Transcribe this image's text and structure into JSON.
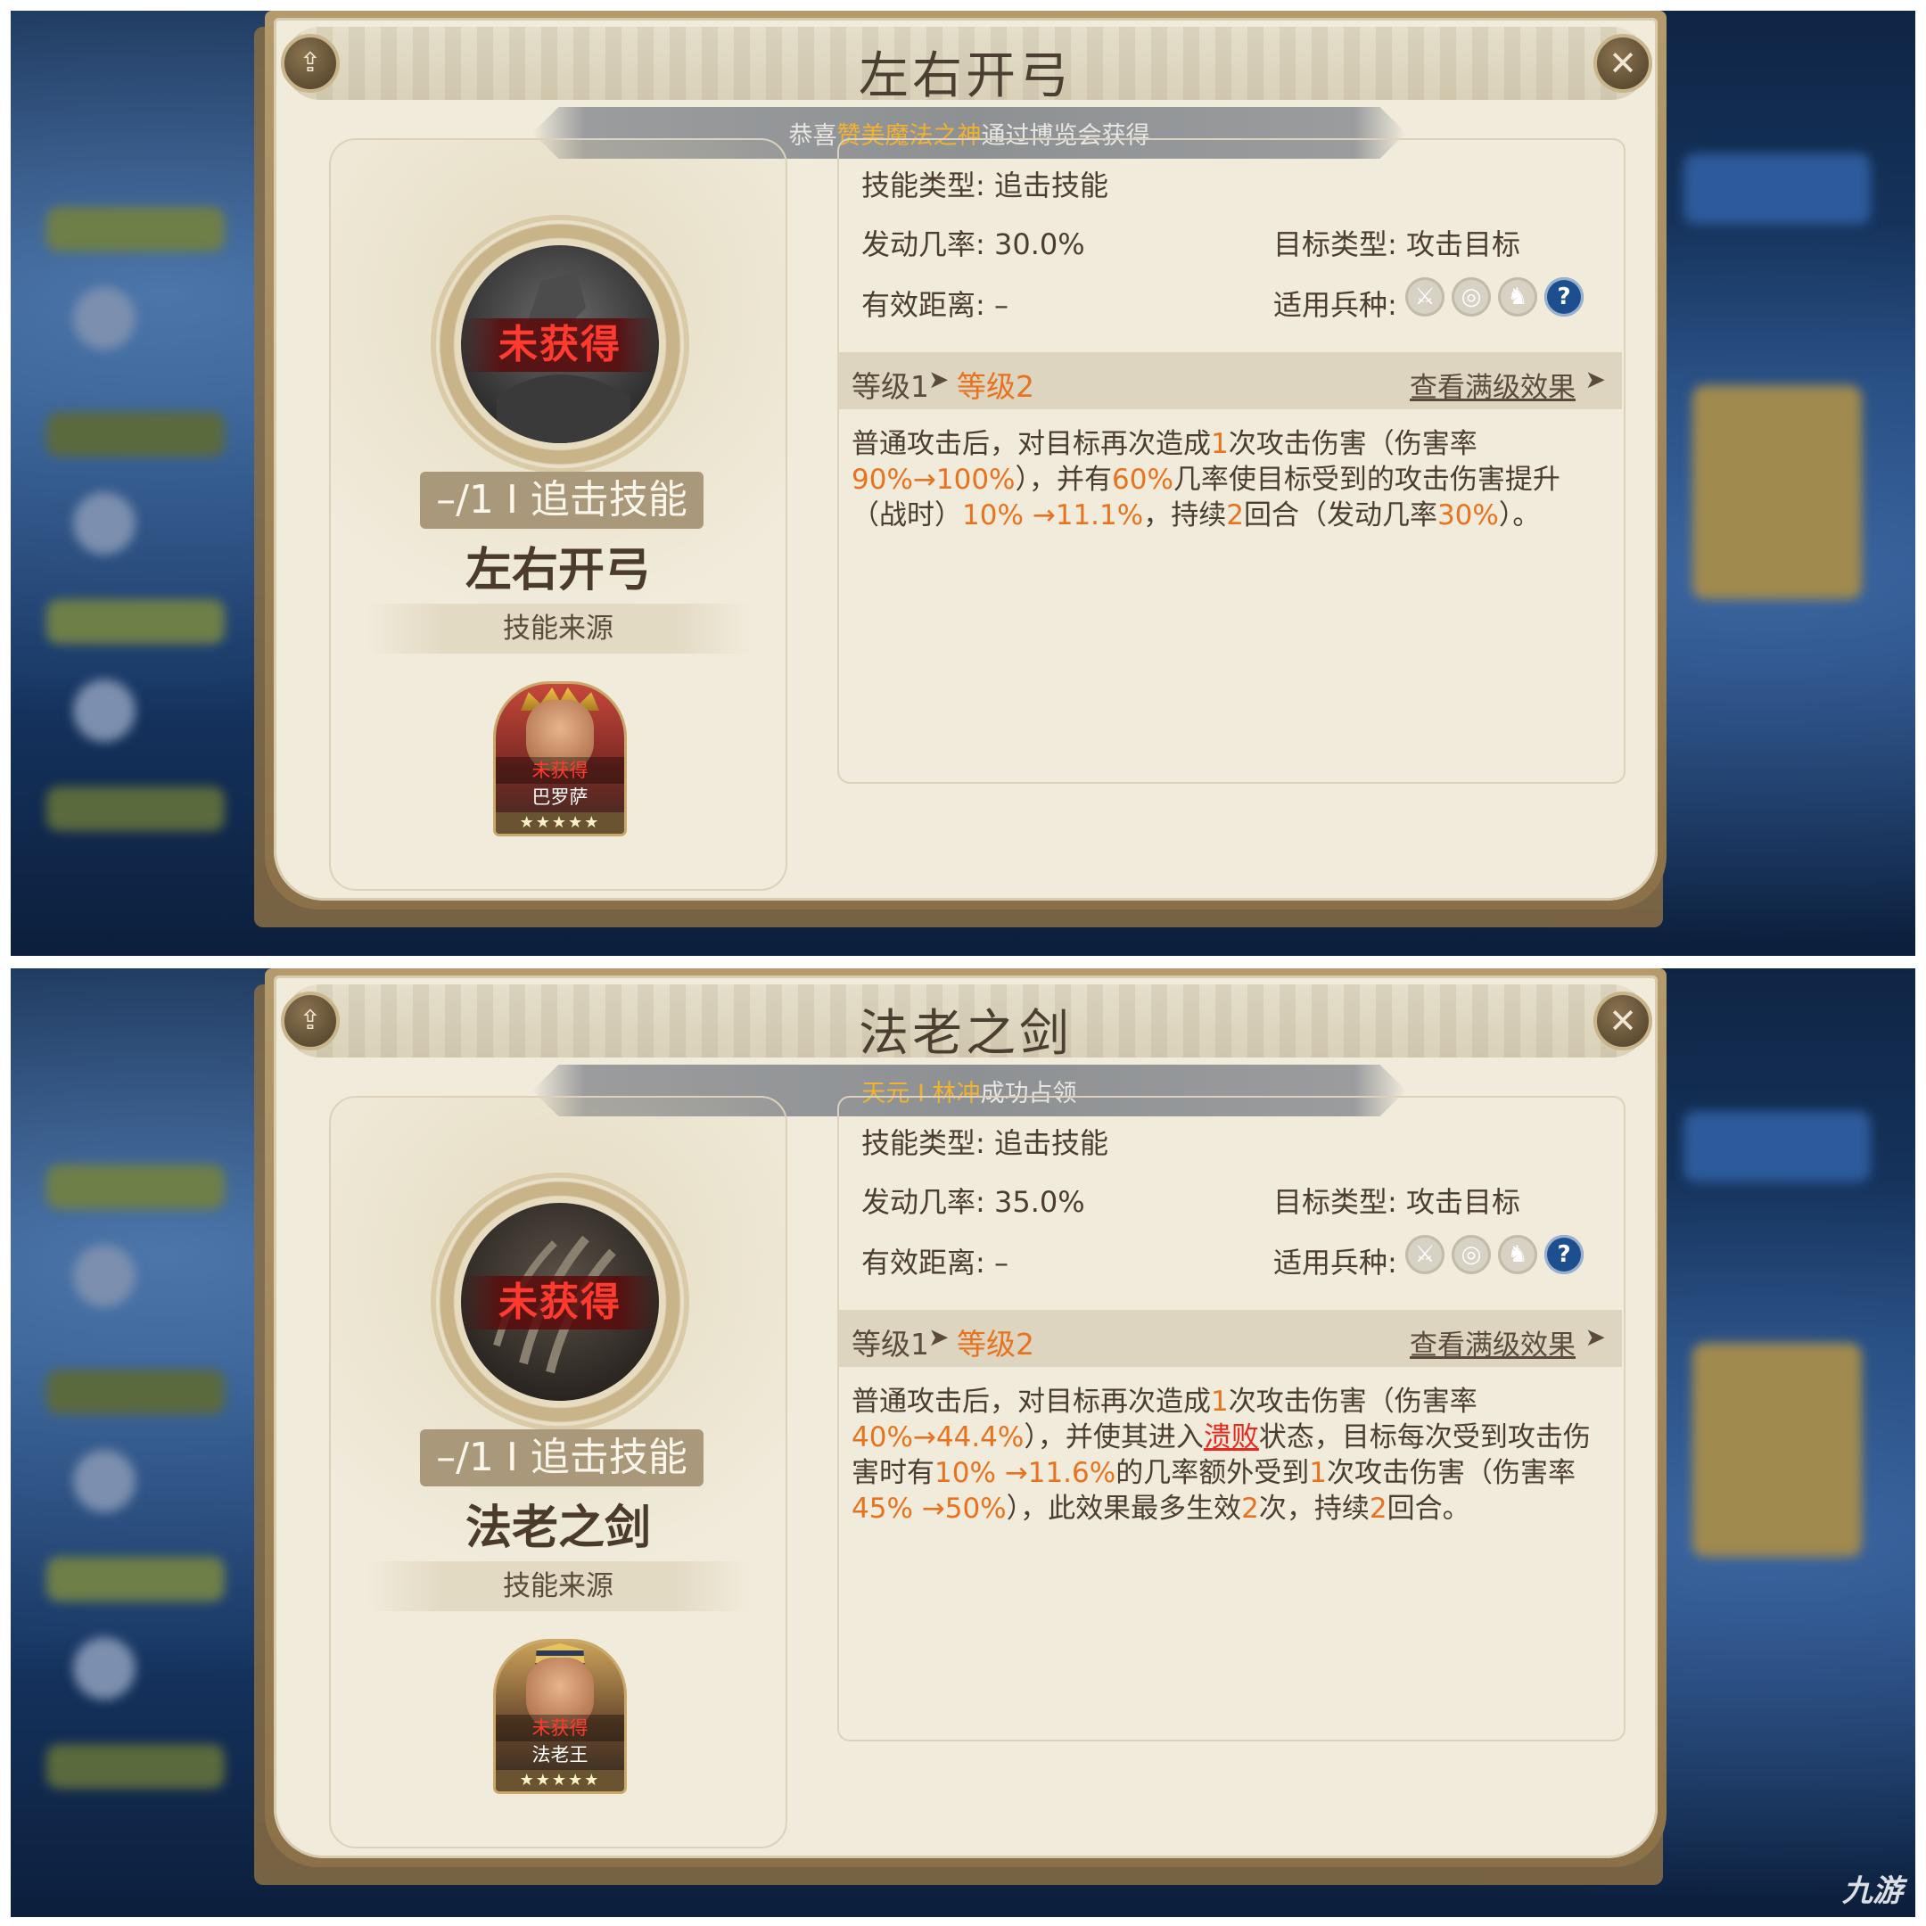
{
  "panels": [
    {
      "title": "左右开弓",
      "banner": {
        "prefix": "恭喜",
        "name": "赞美魔法之神",
        "suffix": "通过博览会获得"
      },
      "skill_badge": "未获得",
      "skill_tag": "–/1 I 追击技能",
      "skill_name": "左右开弓",
      "source_label": "技能来源",
      "hero": {
        "status": "未获得",
        "name": "巴罗萨",
        "stars": "★★★★★"
      },
      "skill_type_label": "技能类型:",
      "skill_type_value": "追击技能",
      "trigger_rate_label": "发动几率:",
      "trigger_rate_value": "30.0%",
      "target_type_label": "目标类型:",
      "target_type_value": "攻击目标",
      "range_label": "有效距离:",
      "range_value": "–",
      "troop_label": "适用兵种:",
      "troop_icons": [
        "sword-icon",
        "target-icon",
        "horse-icon",
        "question-icon"
      ],
      "level_from": "等级1",
      "level_to": "等级2",
      "full_effect": "查看满级效果",
      "desc": [
        {
          "t": "普通攻击后，对目标再次造成"
        },
        {
          "t": "1",
          "c": "o"
        },
        {
          "t": "次攻击伤害（伤害率"
        },
        {
          "t": "90%",
          "c": "o"
        },
        {
          "t": "→100%",
          "c": "o"
        },
        {
          "t": "），并有"
        },
        {
          "t": "60%",
          "c": "o"
        },
        {
          "t": "几率使目标受到的攻击伤害提升（战时）"
        },
        {
          "t": "10% →11.1%",
          "c": "o"
        },
        {
          "t": "，持续"
        },
        {
          "t": "2",
          "c": "o"
        },
        {
          "t": "回合（发动几率"
        },
        {
          "t": "30%",
          "c": "o"
        },
        {
          "t": "）。"
        }
      ]
    },
    {
      "title": "法老之剑",
      "banner": {
        "prefix": "",
        "name": "天元 I 林冲",
        "suffix": "成功占领"
      },
      "skill_badge": "未获得",
      "skill_tag": "–/1 I 追击技能",
      "skill_name": "法老之剑",
      "source_label": "技能来源",
      "hero": {
        "status": "未获得",
        "name": "法老王",
        "stars": "★★★★★"
      },
      "skill_type_label": "技能类型:",
      "skill_type_value": "追击技能",
      "trigger_rate_label": "发动几率:",
      "trigger_rate_value": "35.0%",
      "target_type_label": "目标类型:",
      "target_type_value": "攻击目标",
      "range_label": "有效距离:",
      "range_value": "–",
      "troop_label": "适用兵种:",
      "troop_icons": [
        "sword-icon",
        "target-icon",
        "horse-icon",
        "question-icon"
      ],
      "level_from": "等级1",
      "level_to": "等级2",
      "full_effect": "查看满级效果",
      "desc": [
        {
          "t": "普通攻击后，对目标再次造成"
        },
        {
          "t": "1",
          "c": "o"
        },
        {
          "t": "次攻击伤害（伤害率"
        },
        {
          "t": "40%",
          "c": "o"
        },
        {
          "t": "→44.4%",
          "c": "o"
        },
        {
          "t": "），并使其进入"
        },
        {
          "t": "溃败",
          "c": "r"
        },
        {
          "t": "状态，目标每次受到攻击伤害时有"
        },
        {
          "t": "10% →11.6%",
          "c": "o"
        },
        {
          "t": "的几率额外受到"
        },
        {
          "t": "1",
          "c": "o"
        },
        {
          "t": "次攻击伤害（伤害率"
        },
        {
          "t": "45% →50%",
          "c": "o"
        },
        {
          "t": "），此效果最多生效"
        },
        {
          "t": "2",
          "c": "o"
        },
        {
          "t": "次，持续"
        },
        {
          "t": "2",
          "c": "o"
        },
        {
          "t": "回合。"
        }
      ]
    }
  ],
  "watermark": "九游"
}
